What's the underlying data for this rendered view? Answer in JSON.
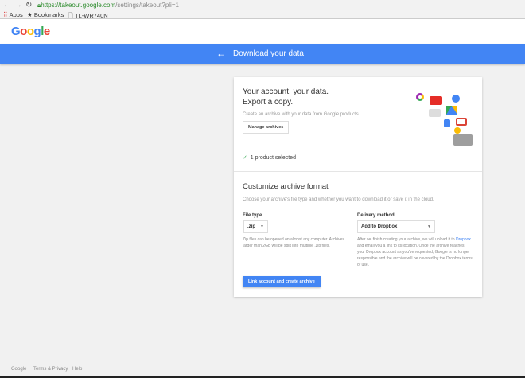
{
  "browser": {
    "url_host": "https://takeout.google.com",
    "url_path": "/settings/takeout?pli=1",
    "bookmarks": [
      {
        "label": "Apps",
        "icon": "apps-grid-icon"
      },
      {
        "label": "Bookmarks",
        "icon": "star-icon"
      },
      {
        "label": "TL-WR740N",
        "icon": "page-icon"
      }
    ]
  },
  "header": {
    "logo": "Google",
    "title": "Download your data"
  },
  "intro": {
    "line1": "Your account, your data.",
    "line2": "Export a copy.",
    "description": "Create an archive with your data from Google products.",
    "manage_button": "Manage archives"
  },
  "products": {
    "selected": "1 product selected"
  },
  "customize": {
    "title": "Customize archive format",
    "description": "Choose your archive's file type and whether you want to download it or save it in the cloud.",
    "file_type": {
      "label": "File type",
      "value": ".zip",
      "help": "Zip files can be opened on almost any computer. Archives larger than 2GB will be split into multiple .zip files."
    },
    "delivery": {
      "label": "Delivery method",
      "value": "Add to Dropbox",
      "help_before": "After we finish creating your archive, we will upload it to",
      "help_link": "Dropbox",
      "help_after": "and email you a link to its location. Once the archive reaches your Dropbox account as you've requested, Google is no longer responsible and the archive will be covered by the Dropbox terms of use."
    },
    "submit": "Link account and create archive"
  },
  "footer": {
    "links": [
      "Google",
      "Terms & Privacy",
      "Help"
    ]
  },
  "colors": {
    "accent": "#4285f4",
    "background": "#f1f1f1"
  }
}
